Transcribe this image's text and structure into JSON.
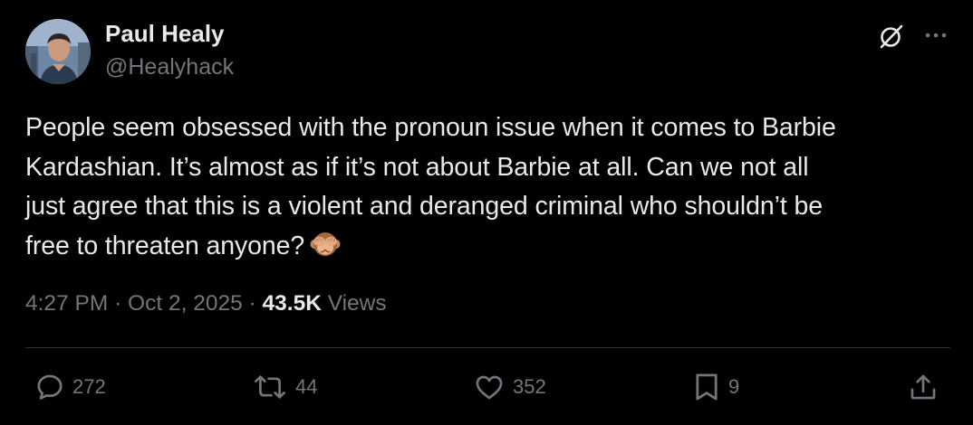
{
  "author": {
    "display_name": "Paul Healy",
    "handle": "@Healyhack"
  },
  "tweet": {
    "text_lines": [
      "People seem obsessed with the pronoun issue when it comes to Barbie",
      "Kardashian. It’s almost as if it’s not about Barbie at all. Can we not all",
      "just agree that this is a violent and deranged criminal who shouldn’t be",
      "free to threaten anyone?"
    ],
    "emoji": "see-no-evil-monkey"
  },
  "meta": {
    "time": "4:27 PM",
    "separator": "·",
    "date": "Oct 2, 2025",
    "views_count": "43.5K",
    "views_label": "Views"
  },
  "actions": {
    "replies": "272",
    "reposts": "44",
    "likes": "352",
    "bookmarks": "9"
  },
  "icons": {
    "header": [
      "grok-icon",
      "more-icon"
    ],
    "actions": [
      "reply-icon",
      "repost-icon",
      "like-icon",
      "bookmark-icon",
      "share-icon"
    ]
  },
  "colors": {
    "background": "#000000",
    "primary_text": "#e7e9ea",
    "secondary_text": "#71767b",
    "divider": "#2f3336"
  }
}
